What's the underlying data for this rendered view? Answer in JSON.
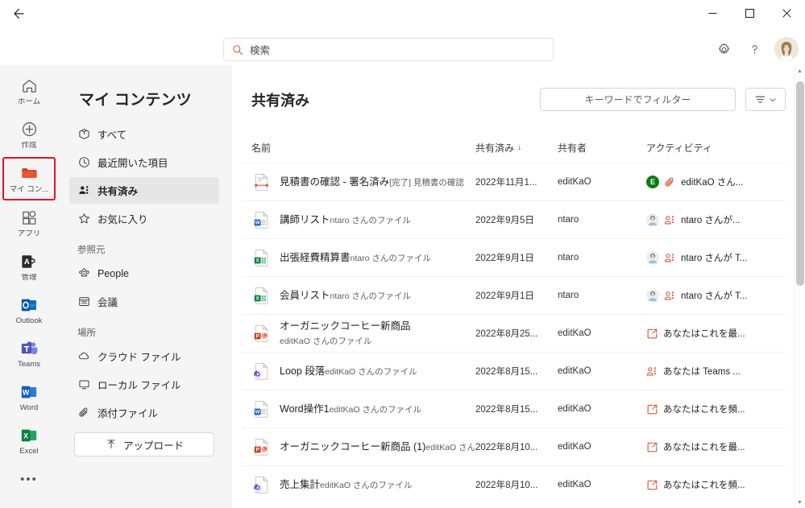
{
  "titlebar": {
    "back_label": "←",
    "minimize_label": "—",
    "maximize_label": "□",
    "close_label": "✕"
  },
  "search": {
    "placeholder": "検索",
    "icon": "search-icon"
  },
  "header_actions": {
    "settings_label": "設定",
    "help_label": "?",
    "avatar_label": "アカウント"
  },
  "rail": {
    "items": [
      {
        "label": "ホーム",
        "icon": "home-icon",
        "selected": false
      },
      {
        "label": "作成",
        "icon": "plus-circle-icon",
        "selected": false
      },
      {
        "label": "マイ コン...",
        "icon": "folder-icon",
        "selected": true
      },
      {
        "label": "アプリ",
        "icon": "apps-icon",
        "selected": false
      },
      {
        "label": "管理",
        "icon": "admin-icon",
        "selected": false
      },
      {
        "label": "Outlook",
        "icon": "outlook-icon",
        "selected": false
      },
      {
        "label": "Teams",
        "icon": "teams-icon",
        "selected": false
      },
      {
        "label": "Word",
        "icon": "word-icon",
        "selected": false
      },
      {
        "label": "Excel",
        "icon": "excel-icon",
        "selected": false
      }
    ],
    "more_label": "•••",
    "selection_highlight_color": "#e81123"
  },
  "nav": {
    "title": "マイ コンテンツ",
    "items": [
      {
        "label": "すべて",
        "icon": "cube-icon",
        "active": false
      },
      {
        "label": "最近開いた項目",
        "icon": "clock-icon",
        "active": false
      },
      {
        "label": "共有済み",
        "icon": "people-shared-icon",
        "active": true
      },
      {
        "label": "お気に入り",
        "icon": "star-icon",
        "active": false
      }
    ],
    "section_source_label": "参照元",
    "source_items": [
      {
        "label": "People",
        "icon": "people-group-icon"
      },
      {
        "label": "会議",
        "icon": "calendar-icon"
      }
    ],
    "section_place_label": "場所",
    "place_items": [
      {
        "label": "クラウド ファイル",
        "icon": "cloud-icon"
      },
      {
        "label": "ローカル ファイル",
        "icon": "monitor-icon"
      },
      {
        "label": "添付ファイル",
        "icon": "paperclip-icon"
      }
    ],
    "upload_label": "アップロード",
    "upload_icon": "upload-arrow-icon"
  },
  "main": {
    "title": "共有済み",
    "filter_placeholder": "キーワードでフィルター",
    "sort_button_label": "並べ替え",
    "columns": {
      "name": "名前",
      "shared": "共有済み",
      "sharer": "共有者",
      "activity": "アクティビティ"
    },
    "sort_indicator": "↓",
    "rows": [
      {
        "title": "見積書の確認 - 署名済み",
        "subtitle": "[完了] 見積書の確認",
        "icon": "signature-doc-icon",
        "shared": "2022年11月1...",
        "sharer": "editKaO",
        "activity": "editKaO さん...",
        "activity_icon": "paperclip-icon",
        "avatar": "badge-e"
      },
      {
        "title": "講師リスト",
        "subtitle": "ntaro さんのファイル",
        "icon": "word-file-icon",
        "shared": "2022年9月5日",
        "sharer": "ntaro",
        "activity": "ntaro さんが...",
        "activity_icon": "people-icon",
        "avatar": "person-photo"
      },
      {
        "title": "出張経費精算書",
        "subtitle": "ntaro さんのファイル",
        "icon": "excel-file-icon",
        "shared": "2022年9月1日",
        "sharer": "ntaro",
        "activity": "ntaro さんが T...",
        "activity_icon": "people-icon",
        "avatar": "person-photo"
      },
      {
        "title": "会員リスト",
        "subtitle": "ntaro さんのファイル",
        "icon": "excel-file-icon",
        "shared": "2022年9月1日",
        "sharer": "ntaro",
        "activity": "ntaro さんが T...",
        "activity_icon": "people-icon",
        "avatar": "person-photo"
      },
      {
        "title": "オーガニックコーヒー新商品",
        "subtitle": "editKaO さんのファイル",
        "icon": "powerpoint-file-icon",
        "shared": "2022年8月25...",
        "sharer": "editKaO",
        "activity": "あなたはこれを最...",
        "activity_icon": "open-link-icon",
        "avatar": "none"
      },
      {
        "title": "Loop 段落",
        "subtitle": "editKaO さんのファイル",
        "icon": "loop-file-icon",
        "shared": "2022年8月15...",
        "sharer": "editKaO",
        "activity": "あなたは Teams ...",
        "activity_icon": "people-icon",
        "avatar": "none"
      },
      {
        "title": "Word操作1",
        "subtitle": "editKaO さんのファイル",
        "icon": "word-file-icon",
        "shared": "2022年8月15...",
        "sharer": "editKaO",
        "activity": "あなたはこれを頻...",
        "activity_icon": "open-link-icon",
        "avatar": "none"
      },
      {
        "title": "オーガニックコーヒー新商品 (1)",
        "subtitle": "editKaO さんのファイル",
        "icon": "powerpoint-file-icon",
        "shared": "2022年8月10...",
        "sharer": "editKaO",
        "activity": "あなたはこれを最...",
        "activity_icon": "open-link-icon",
        "avatar": "none"
      },
      {
        "title": "売上集計",
        "subtitle": "editKaO さんのファイル",
        "icon": "loop-file-icon",
        "shared": "2022年8月10...",
        "sharer": "editKaO",
        "activity": "あなたはこれを頻...",
        "activity_icon": "open-link-icon",
        "avatar": "none"
      }
    ]
  },
  "colors": {
    "accent_red": "#d83b01",
    "word_blue": "#185abd",
    "excel_green": "#107c41",
    "powerpoint_orange": "#c43e1c",
    "loop_purple": "#5b2d90",
    "highlight": "#e81123"
  }
}
